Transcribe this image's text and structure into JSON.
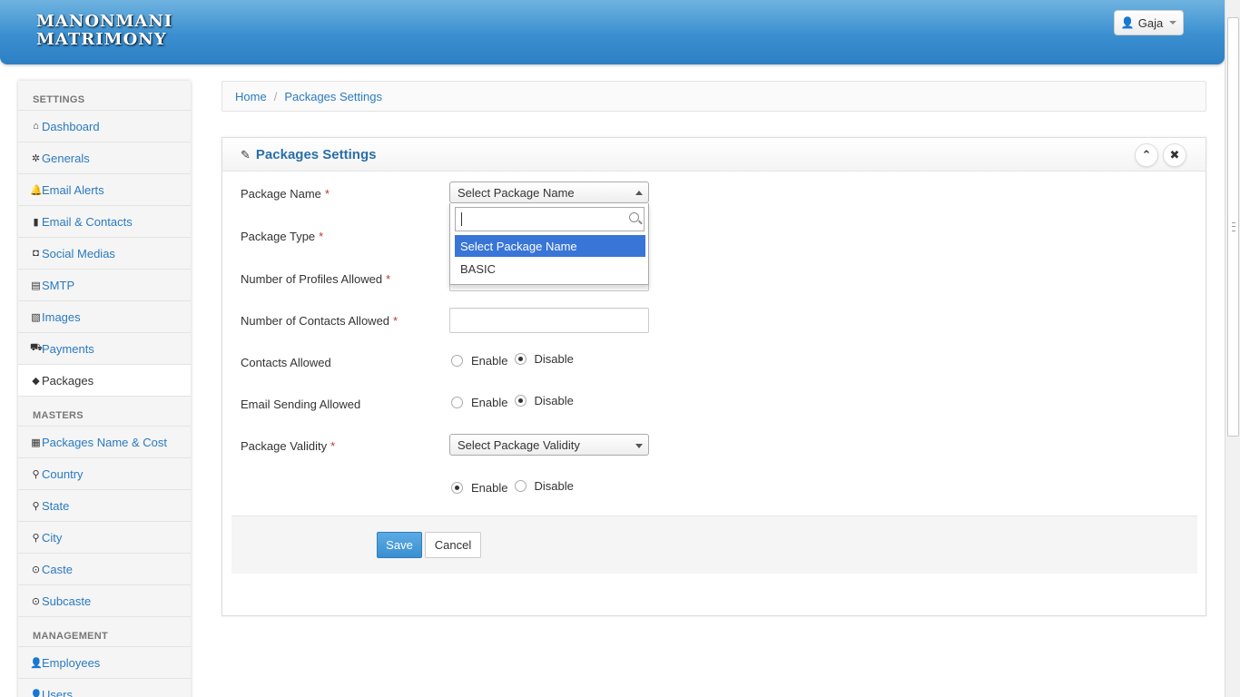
{
  "brand": {
    "line1": "ManonMani",
    "line2": "Matrimony"
  },
  "user": {
    "name": "Gaja",
    "icon": "user-icon"
  },
  "sidebar": {
    "sections": [
      {
        "header": "SETTINGS",
        "items": [
          {
            "label": "Dashboard",
            "icon": "home-icon",
            "glyph": "⌂"
          },
          {
            "label": "Generals",
            "icon": "cog-icon",
            "glyph": "✲"
          },
          {
            "label": "Email Alerts",
            "icon": "bell-icon",
            "glyph": "🔔"
          },
          {
            "label": "Email & Contacts",
            "icon": "book-icon",
            "glyph": "▮"
          },
          {
            "label": "Social Medias",
            "icon": "camera-icon",
            "glyph": "◘"
          },
          {
            "label": "SMTP",
            "icon": "hdd-icon",
            "glyph": "▤"
          },
          {
            "label": "Images",
            "icon": "picture-icon",
            "glyph": "▧"
          },
          {
            "label": "Payments",
            "icon": "cart-icon",
            "glyph": "⛟"
          },
          {
            "label": "Packages",
            "icon": "tag-icon",
            "glyph": "◆",
            "active": true
          }
        ]
      },
      {
        "header": "MASTERS",
        "items": [
          {
            "label": "Packages Name & Cost",
            "icon": "qrcode-icon",
            "glyph": "▦"
          },
          {
            "label": "Country",
            "icon": "map-marker-icon",
            "glyph": "⚲"
          },
          {
            "label": "State",
            "icon": "map-marker-icon",
            "glyph": "⚲"
          },
          {
            "label": "City",
            "icon": "map-marker-icon",
            "glyph": "⚲"
          },
          {
            "label": "Caste",
            "icon": "circle-arrow-icon",
            "glyph": "⊙"
          },
          {
            "label": "Subcaste",
            "icon": "circle-arrow-icon",
            "glyph": "⊙"
          }
        ]
      },
      {
        "header": "MANAGEMENT",
        "items": [
          {
            "label": "Employees",
            "icon": "user-icon",
            "glyph": "👤"
          },
          {
            "label": "Users",
            "icon": "user-icon",
            "glyph": "👤"
          }
        ]
      }
    ]
  },
  "breadcrumb": {
    "home": "Home",
    "current": "Packages Settings"
  },
  "panel": {
    "title": "Packages Settings",
    "fields": {
      "package_name": "Package Name",
      "package_type": "Package Type",
      "profiles_allowed": "Number of Profiles Allowed",
      "contacts_allowed_count": "Number of Contacts Allowed",
      "contacts_allowed": "Contacts Allowed",
      "email_sending": "Email Sending Allowed",
      "validity": "Package Validity",
      "required_mark": "*"
    },
    "package_name_select": "Select Package Name",
    "validity_select": "Select Package Validity",
    "enable_label": "Enable",
    "disable_label": "Disable",
    "contacts_allowed_value": "Disable",
    "email_sending_value": "Disable",
    "status_value": "Enable",
    "save": "Save",
    "cancel": "Cancel"
  },
  "dropdown": {
    "search_value": "",
    "options": [
      "Select Package Name",
      "BASIC"
    ],
    "highlighted": "Select Package Name"
  }
}
